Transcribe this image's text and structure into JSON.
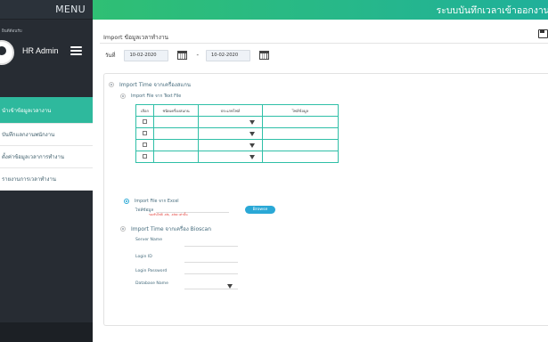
{
  "sidebar": {
    "menu_title": "MENU",
    "welcome": "ยินดีต้อนรับ",
    "user_name": "HR Admin",
    "items": [
      {
        "label": "นำเข้าข้อมูลเวลางาน"
      },
      {
        "label": "บันทึกแลกงานพนักงาน"
      },
      {
        "label": "ตั้งค่าข้อมูลเวลาการทำงาน"
      },
      {
        "label": "รายงานการเวลาทำงาน"
      }
    ]
  },
  "topbar": {
    "app_title": "ระบบบันทึกเวลาเข้าออกงาน"
  },
  "main": {
    "page_title": "Import ข้อมูลเวลาทำงาน",
    "date_label": "วันที่",
    "date_from": "10-02-2020",
    "date_to": "10-02-2020",
    "dash": "-",
    "options": {
      "scanner": "Import Time จากเครื่องสแกน",
      "text_file": "Import File จาก Text File",
      "excel": "Import File จาก Excel",
      "bioscan": "Import Time จากเครื่อง Bioscan"
    },
    "table": {
      "headers": [
        "เลือก",
        "ชนิดเครื่องสแกน",
        "ประเภทไฟล์",
        "ไฟล์ข้อมูล"
      ],
      "rows": 4
    },
    "excel": {
      "file_label": "ไฟล์ข้อมูล",
      "hint": "รองรับไฟล์ .xls, .xlsx เท่านั้น",
      "browse": "Browse"
    },
    "bioscan": {
      "server_name": "Server Name",
      "login_id": "Login ID",
      "login_password": "Login Password",
      "database_name": "Database Name"
    }
  }
}
